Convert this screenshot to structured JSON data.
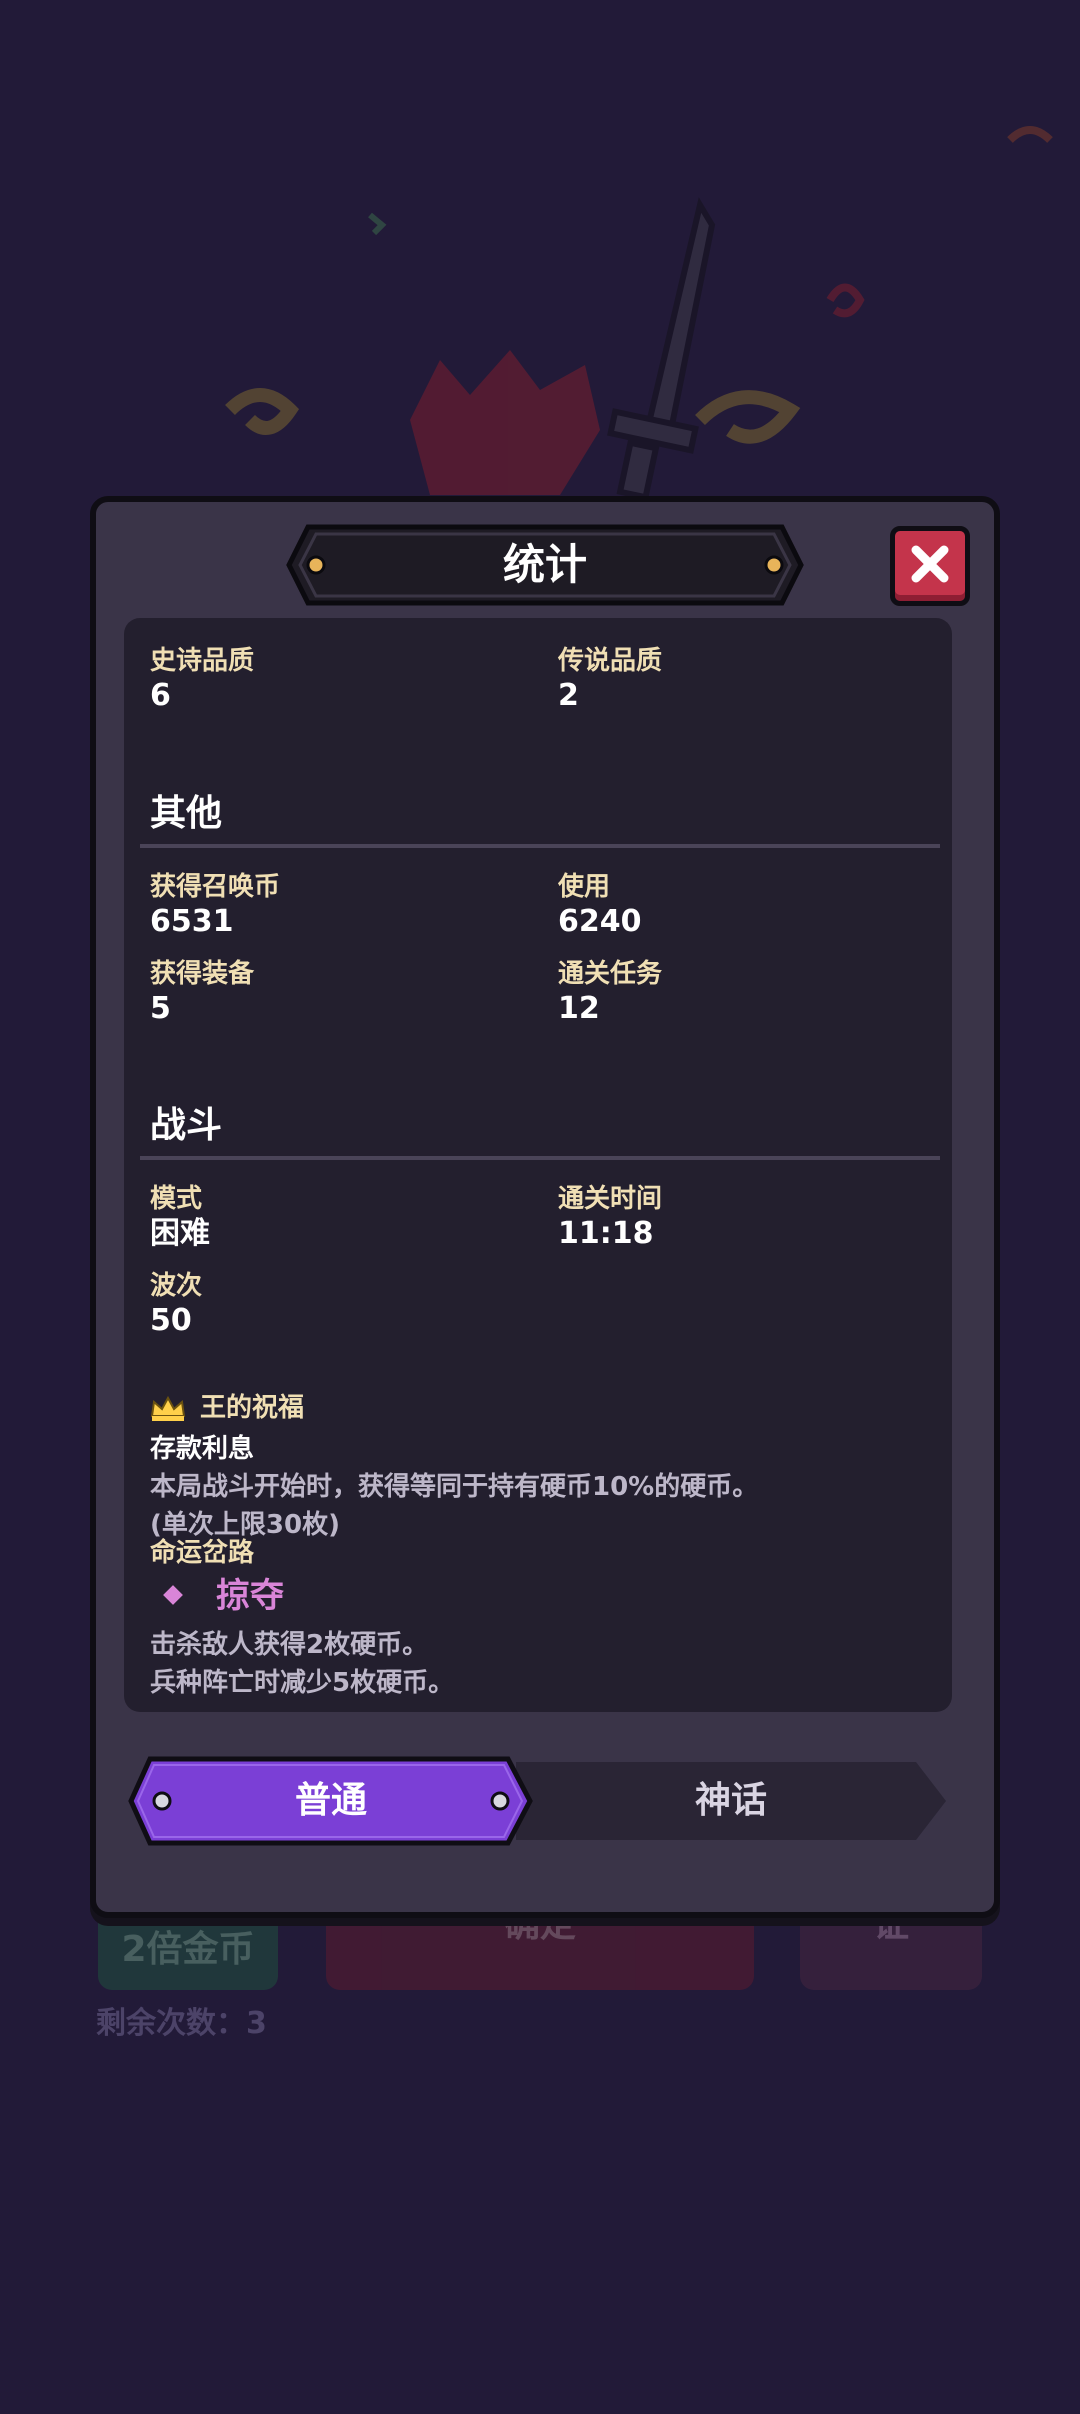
{
  "background": {
    "coins_button_label": "2倍金币",
    "confirm_button_label": "确定",
    "third_button_label": "证",
    "remaining_label": "剩余次数：3"
  },
  "modal": {
    "title": "统计",
    "close_icon": "close-icon",
    "quality": {
      "epic_label": "史诗品质",
      "epic_value": "6",
      "legend_label": "传说品质",
      "legend_value": "2"
    },
    "other": {
      "title": "其他",
      "summon_label": "获得召唤币",
      "summon_value": "6531",
      "used_label": "使用",
      "used_value": "6240",
      "gear_label": "获得装备",
      "gear_value": "5",
      "quest_label": "通关任务",
      "quest_value": "12"
    },
    "battle": {
      "title": "战斗",
      "mode_label": "模式",
      "mode_value": "困难",
      "time_label": "通关时间",
      "time_value": "11:18",
      "wave_label": "波次",
      "wave_value": "50"
    },
    "blessing": {
      "icon": "crown-icon",
      "title": "王的祝福",
      "name": "存款利息",
      "desc_line1": "本局战斗开始时，获得等同于持有硬币10%的硬币。",
      "desc_line2": "(单次上限30枚)"
    },
    "fate": {
      "title": "命运岔路",
      "icon": "diamond-icon",
      "name": "掠夺",
      "desc_line1": "击杀敌人获得2枚硬币。",
      "desc_line2": "兵种阵亡时减少5枚硬币。"
    },
    "tabs": [
      {
        "label": "普通",
        "active": true
      },
      {
        "label": "神话",
        "active": false
      }
    ]
  },
  "colors": {
    "background": "#221a38",
    "panel": "#3a3448",
    "content": "#231f2e",
    "label": "#f0dfb4",
    "active_tab": "#7b3fd6",
    "close_button": "#c4344b",
    "fate_accent": "#d985d8"
  }
}
